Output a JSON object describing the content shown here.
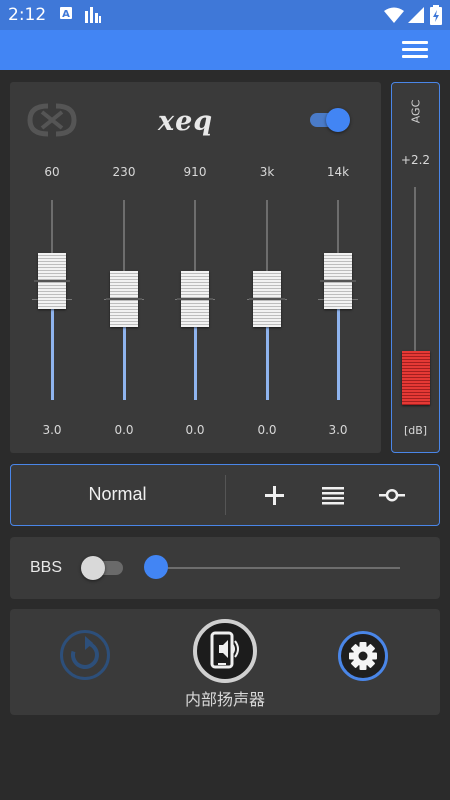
{
  "status_bar": {
    "time": "2:12",
    "icons": [
      "notification-a-icon",
      "signal-bars-icon",
      "wifi-icon",
      "cell-signal-icon",
      "battery-charging-icon"
    ]
  },
  "app_bar": {
    "menu_icon": "hamburger-menu-icon"
  },
  "equalizer": {
    "logo_text": "xeq",
    "enabled": true,
    "bands": [
      {
        "freq": "60",
        "gain": "3.0"
      },
      {
        "freq": "230",
        "gain": "0.0"
      },
      {
        "freq": "910",
        "gain": "0.0"
      },
      {
        "freq": "3k",
        "gain": "0.0"
      },
      {
        "freq": "14k",
        "gain": "3.0"
      }
    ]
  },
  "agc": {
    "label": "AGC",
    "value": "+2.2",
    "unit": "[dB]"
  },
  "preset": {
    "name": "Normal",
    "add_icon": "plus-icon",
    "list_icon": "list-icon",
    "more_icon": "node-icon"
  },
  "bbs": {
    "label": "BBS",
    "enabled": false,
    "level": 0
  },
  "bottom": {
    "reset_icon": "reset-icon",
    "output_icon": "phone-speaker-icon",
    "output_label": "内部扬声器",
    "settings_icon": "gear-icon"
  },
  "colors": {
    "accent": "#4285f4",
    "status_bar": "#3f78d8",
    "background": "#2b2b2b",
    "panel": "#3a3a3a",
    "agc_knob": "#e53935"
  }
}
